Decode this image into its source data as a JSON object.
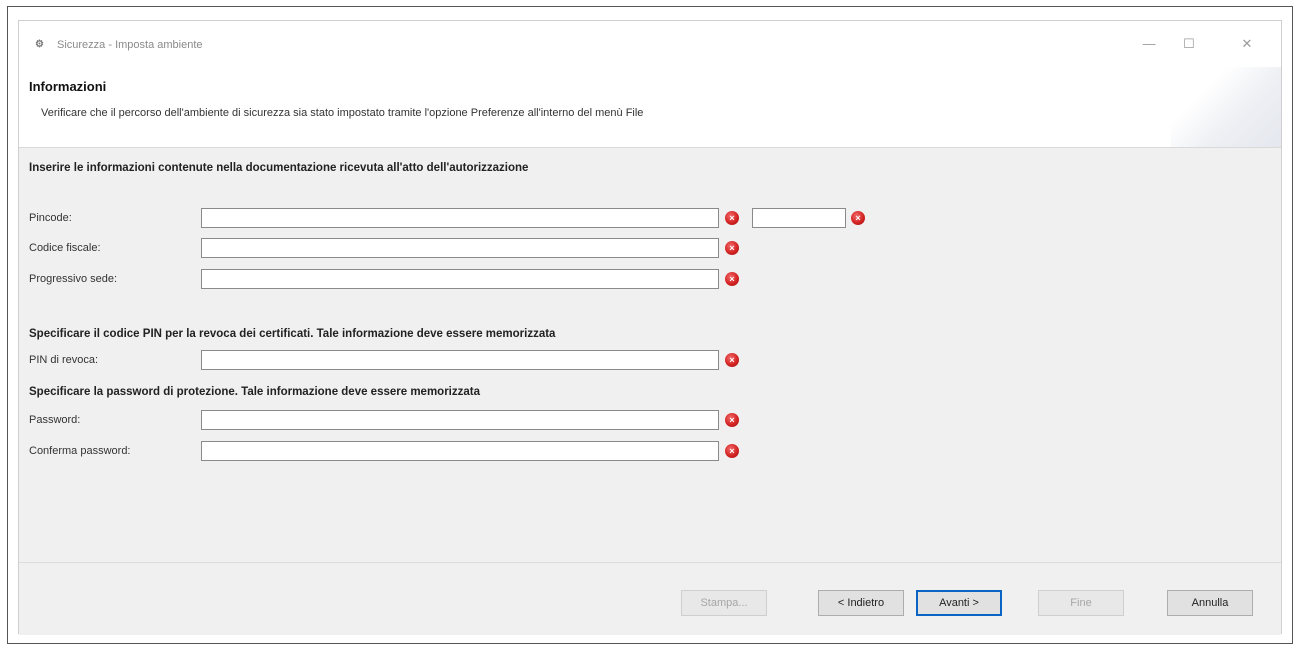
{
  "window": {
    "title": "Sicurezza - Imposta ambiente",
    "controls": {
      "minimize": "—",
      "maximize": "☐",
      "close": "✕"
    }
  },
  "header": {
    "title": "Informazioni",
    "description": "Verificare che il percorso dell'ambiente di sicurezza sia stato impostato tramite l'opzione Preferenze all'interno del menù File"
  },
  "sections": {
    "auth_info": "Inserire le informazioni contenute nella documentazione ricevuta all'atto dell'autorizzazione",
    "pin_info": "Specificare il codice PIN per la revoca dei certificati. Tale informazione deve essere memorizzata",
    "password_info": "Specificare la password di protezione. Tale informazione deve essere memorizzata"
  },
  "fields": {
    "pincode": {
      "label": "Pincode:",
      "value": "",
      "extra_value": ""
    },
    "codice_fiscale": {
      "label": "Codice fiscale:",
      "value": ""
    },
    "progressivo_sede": {
      "label": "Progressivo sede:",
      "value": ""
    },
    "pin_revoca": {
      "label": "PIN di revoca:",
      "value": ""
    },
    "password": {
      "label": "Password:",
      "value": ""
    },
    "conferma_password": {
      "label": "Conferma password:",
      "value": ""
    }
  },
  "error_icon": {
    "name": "error-icon",
    "glyph": "×",
    "color": "#d42424"
  },
  "buttons": {
    "stampa": "Stampa...",
    "indietro": "< Indietro",
    "avanti": "Avanti >",
    "fine": "Fine",
    "annulla": "Annulla"
  },
  "colors": {
    "accent": "#0a64c4",
    "error": "#d42424",
    "panel": "#f0f0f0"
  }
}
